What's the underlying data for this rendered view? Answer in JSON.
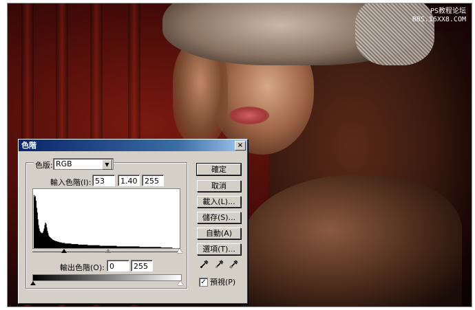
{
  "watermark": {
    "line1": "PS教程论坛",
    "line2": "BBS.16XX8.COM"
  },
  "dialog": {
    "title": "色階",
    "close_glyph": "×",
    "channel_label": "色版:",
    "channel_value": "RGB",
    "input_levels_label": "輸入色階(I):",
    "input_black": "53",
    "input_gamma": "1.40",
    "input_white": "255",
    "output_levels_label": "輸出色階(O):",
    "output_black": "0",
    "output_white": "255",
    "buttons": {
      "ok": "確定",
      "cancel": "取消",
      "load": "載入(L)...",
      "save": "儲存(S)...",
      "auto": "自動(A)",
      "options": "選項(T)..."
    },
    "preview_label": "預視(P)",
    "preview_checked": true
  },
  "histogram": {
    "channel": "RGB",
    "levels": [
      0,
      92,
      88,
      90,
      82,
      70,
      62,
      50,
      40,
      34,
      30,
      28,
      27,
      26,
      26,
      27,
      30,
      34,
      40,
      44,
      42,
      36,
      30,
      26,
      22,
      20,
      19,
      18,
      17,
      16,
      15,
      14,
      14,
      13,
      13,
      12,
      12,
      12,
      11,
      11,
      11,
      10,
      10,
      10,
      10,
      9,
      9,
      9,
      9,
      9,
      8,
      8,
      8,
      8,
      8,
      8,
      8,
      8,
      8,
      8,
      7,
      7,
      7,
      7,
      7,
      7,
      7,
      7,
      7,
      7,
      7,
      6,
      6,
      6,
      6,
      6,
      6,
      6,
      6,
      6,
      6,
      6,
      6,
      6,
      6,
      6,
      5,
      5,
      5,
      5,
      5,
      5,
      5,
      5,
      5,
      5,
      5,
      5,
      5,
      5,
      5,
      5,
      5,
      5,
      5,
      4,
      4,
      4,
      4,
      4,
      4,
      4,
      4,
      4,
      4,
      4,
      4,
      4,
      4,
      4,
      4,
      4,
      4,
      4,
      4,
      4,
      4,
      4,
      4,
      4,
      4,
      4,
      3,
      3,
      3,
      3,
      3,
      3,
      3,
      3,
      3,
      3,
      3,
      3,
      3,
      3,
      3,
      3,
      3,
      3,
      3,
      3,
      3,
      3,
      3,
      3,
      3,
      3,
      3,
      3,
      3,
      3,
      3,
      3,
      3,
      3,
      3,
      3,
      2,
      2,
      2,
      2,
      2,
      2,
      2,
      2,
      2,
      2,
      2,
      2,
      2,
      2,
      2,
      2,
      2,
      2,
      2,
      2,
      2,
      2,
      2,
      2,
      2,
      2,
      2,
      2,
      2,
      2,
      2,
      2,
      2,
      2,
      1,
      1,
      1,
      1,
      1,
      1,
      1,
      1,
      1,
      1,
      1,
      1,
      1,
      1,
      1,
      1,
      1,
      1,
      0,
      0,
      0,
      0,
      0,
      0,
      0,
      0,
      0,
      0,
      0,
      0
    ]
  }
}
